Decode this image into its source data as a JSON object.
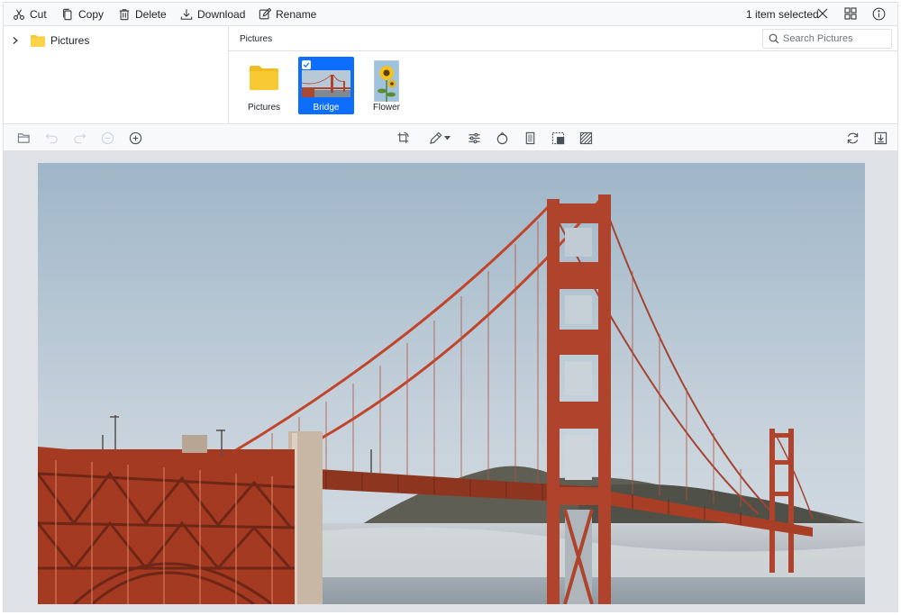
{
  "toolbar": {
    "cut_label": "Cut",
    "copy_label": "Copy",
    "delete_label": "Delete",
    "download_label": "Download",
    "rename_label": "Rename",
    "selection_status": "1 item selected"
  },
  "navigation": {
    "folder_label": "Pictures"
  },
  "content": {
    "breadcrumb": "Pictures",
    "search_placeholder": "Search Pictures",
    "items": [
      {
        "name": "Pictures",
        "type": "folder"
      },
      {
        "name": "Bridge",
        "type": "image",
        "selected": true
      },
      {
        "name": "Flower",
        "type": "image"
      }
    ]
  },
  "colors": {
    "accent": "#0d6efd",
    "folder": "#f8c932",
    "bridge": "#c0452b"
  }
}
